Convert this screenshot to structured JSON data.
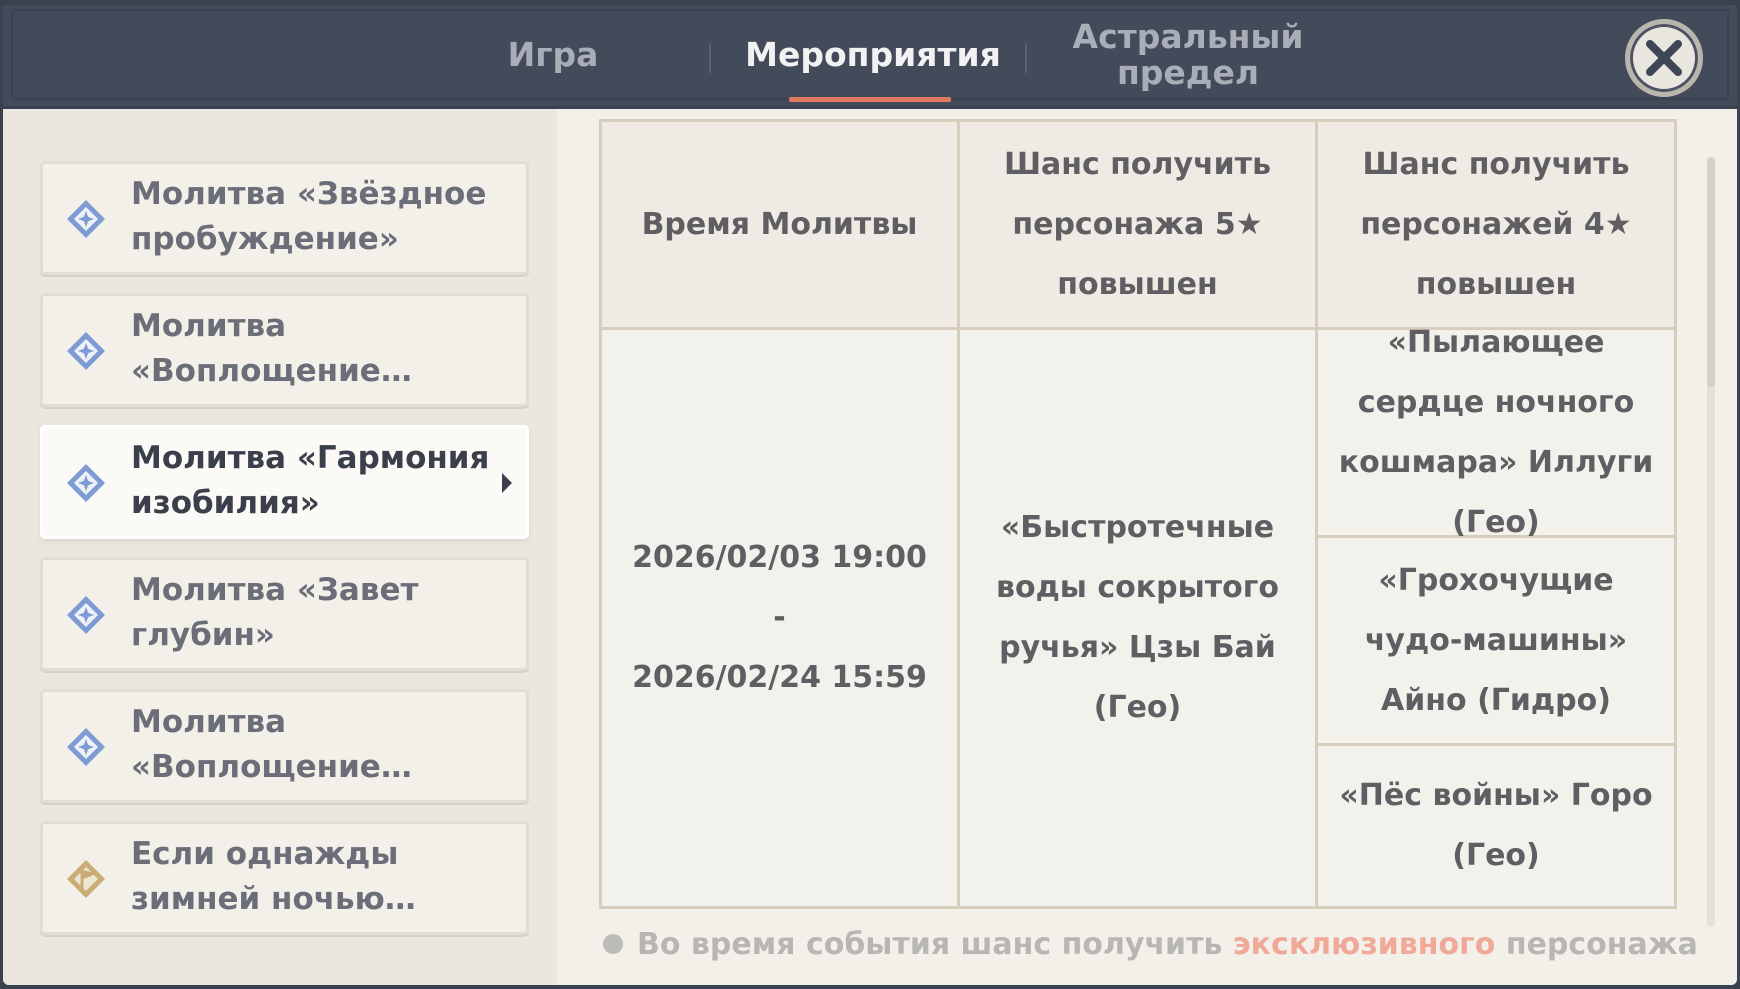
{
  "header": {
    "tabs": [
      {
        "label": "Игра"
      },
      {
        "label": "Мероприятия"
      },
      {
        "label": "Астральный предел"
      }
    ],
    "active_tab": "Мероприятия",
    "accent_color": "#e07a5f"
  },
  "sidebar": {
    "items": [
      {
        "label": "Молитва «Звёздное пробуждение»",
        "icon": "diamond-star-icon"
      },
      {
        "label": "Молитва «Воплощение…",
        "icon": "diamond-star-icon"
      },
      {
        "label": "Молитва «Гармония изобилия»",
        "icon": "diamond-star-icon",
        "active": true
      },
      {
        "label": "Молитва «Завет глубин»",
        "icon": "diamond-star-icon"
      },
      {
        "label": "Молитва «Воплощение…",
        "icon": "diamond-star-icon"
      },
      {
        "label": "Если однажды зимней ночью…",
        "icon": "flag-diamond-icon"
      }
    ]
  },
  "table": {
    "headers": [
      "Время Молитвы",
      "Шанс получить персонажа 5★ повышен",
      "Шанс получить персонажей 4★ повышен"
    ],
    "time": {
      "start": "2026/02/03 19:00",
      "sep": "-",
      "end": "2026/02/24 15:59"
    },
    "five_star": "«Быстротечные воды сокрытого ручья» Цзы Бай (Гео)",
    "four_star": [
      "«Пылающее сердце ночного кошмара» Иллуги (Гео)",
      "«Грохочущие чудо-машины» Айно (Гидро)",
      "«Пёс войны» Горо (Гео)"
    ]
  },
  "note": {
    "prefix": "Во время события шанс получить ",
    "highlight": "эксклюзивного",
    "suffix": " персонажа"
  }
}
